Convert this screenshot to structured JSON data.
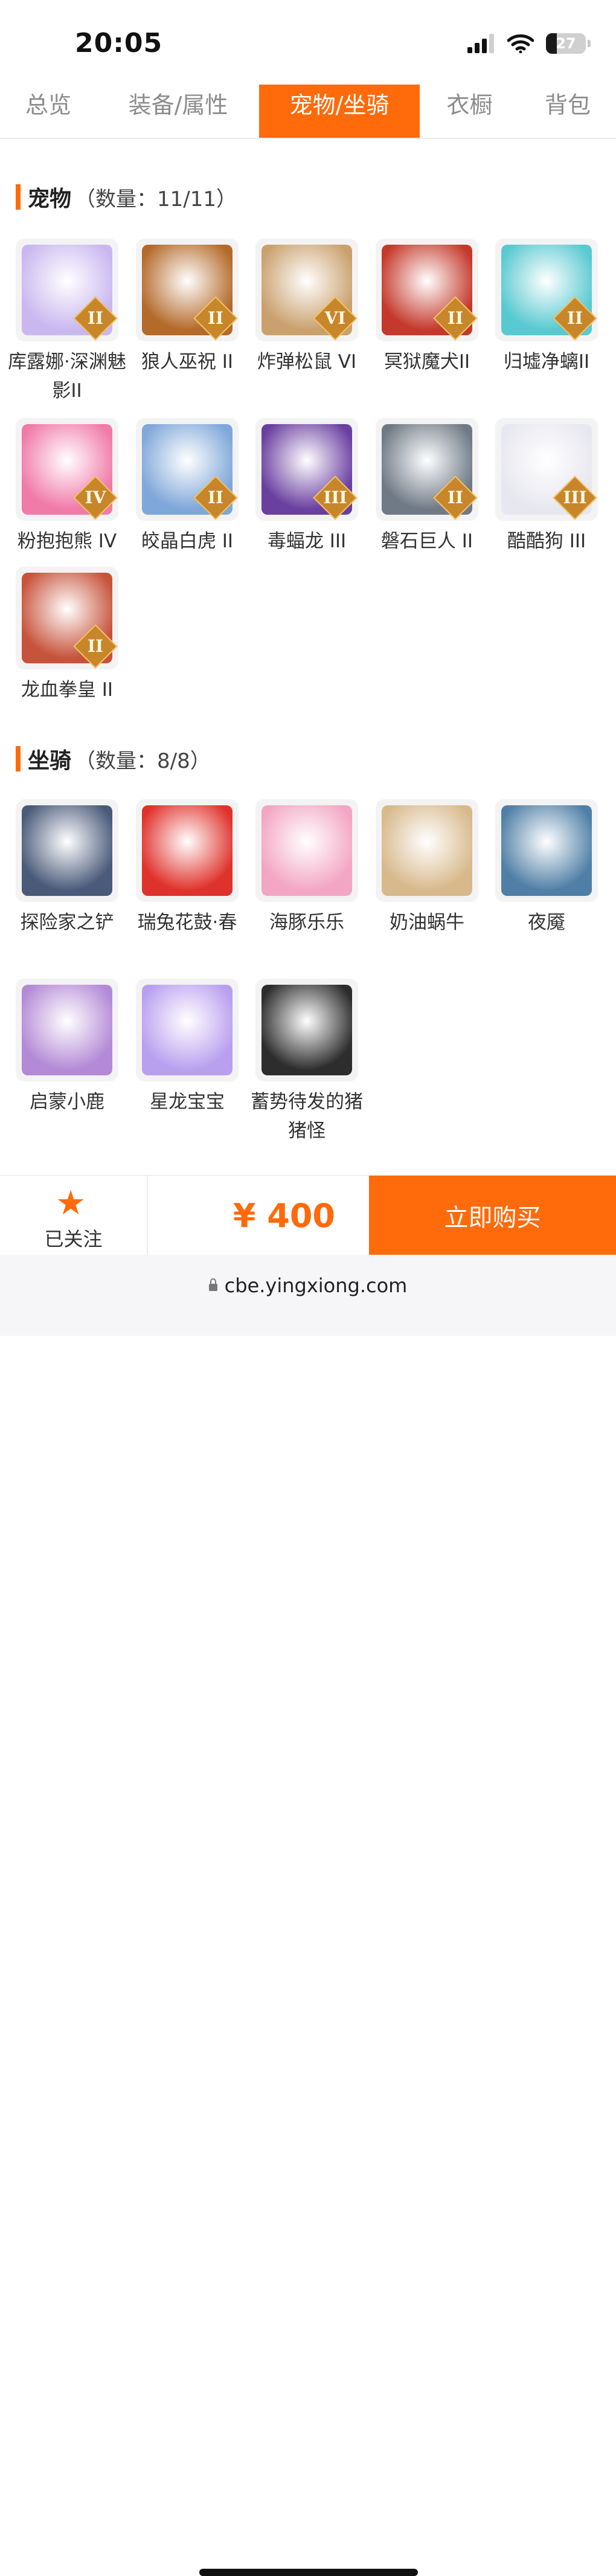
{
  "status": {
    "time": "20:05",
    "battery": "27",
    "battery_level": 0.27
  },
  "tabs": [
    {
      "label": "总览",
      "active": false
    },
    {
      "label": "装备/属性",
      "active": false
    },
    {
      "label": "宠物/坐骑",
      "active": true
    },
    {
      "label": "衣橱",
      "active": false
    },
    {
      "label": "背包",
      "active": false
    }
  ],
  "pets": {
    "title": "宠物",
    "count": "（数量：11/11）",
    "items": [
      {
        "name": "库露娜·深渊魅影II",
        "grade": "II",
        "icon": "pet-kuluna",
        "color": "#c9b8f0"
      },
      {
        "name": "狼人巫祝 II",
        "grade": "II",
        "icon": "pet-werewolf",
        "color": "#b46a2a"
      },
      {
        "name": "炸弹松鼠 VI",
        "grade": "VI",
        "icon": "pet-bomb-squirrel",
        "color": "#caa16e"
      },
      {
        "name": "冥狱魔犬II",
        "grade": "II",
        "icon": "pet-hellhound",
        "color": "#c4392b"
      },
      {
        "name": "归墟净螭II",
        "grade": "II",
        "icon": "pet-dragon-cyan",
        "color": "#59c9d1"
      },
      {
        "name": "粉抱抱熊 IV",
        "grade": "IV",
        "icon": "pet-pink-bear",
        "color": "#f07aa8"
      },
      {
        "name": "皎晶白虎 II",
        "grade": "II",
        "icon": "pet-white-tiger",
        "color": "#7fa7d9"
      },
      {
        "name": "毒蝠龙 III",
        "grade": "III",
        "icon": "pet-bat-dragon",
        "color": "#6a3fa0"
      },
      {
        "name": "磐石巨人 II",
        "grade": "II",
        "icon": "pet-rock-giant",
        "color": "#6f7a86"
      },
      {
        "name": "酷酷狗 III",
        "grade": "III",
        "icon": "pet-cool-dog",
        "color": "#e7e7ef"
      },
      {
        "name": "龙血拳皇 II",
        "grade": "II",
        "icon": "pet-dragonblood",
        "color": "#c7533b"
      }
    ]
  },
  "mounts": {
    "title": "坐骑",
    "count": "（数量：8/8）",
    "items": [
      {
        "name": "探险家之铲",
        "icon": "mount-shovel",
        "color": "#4a5a7a"
      },
      {
        "name": "瑞兔花鼓·春",
        "icon": "mount-drum",
        "color": "#e0322c"
      },
      {
        "name": "海豚乐乐",
        "icon": "mount-dolphin",
        "color": "#f3a6c3"
      },
      {
        "name": "奶油蜗牛",
        "icon": "mount-snail",
        "color": "#d8b98c"
      },
      {
        "name": "夜魇",
        "icon": "mount-nightmare",
        "color": "#4f7fa6"
      },
      {
        "name": "启蒙小鹿",
        "icon": "mount-deer",
        "color": "#b48ad6"
      },
      {
        "name": "星龙宝宝",
        "icon": "mount-star-dragon",
        "color": "#b9a0ef"
      },
      {
        "name": "蓄势待发的猪猪怪",
        "icon": "mount-pig",
        "color": "#2d2d2d"
      }
    ]
  },
  "bottom": {
    "follow_label": "已关注",
    "follow_icon": "star-icon",
    "price": "¥ 400",
    "buy_label": "立即购买"
  },
  "browser": {
    "url": "cbe.yingxiong.com"
  },
  "colors": {
    "accent": "#ff6a0a"
  }
}
